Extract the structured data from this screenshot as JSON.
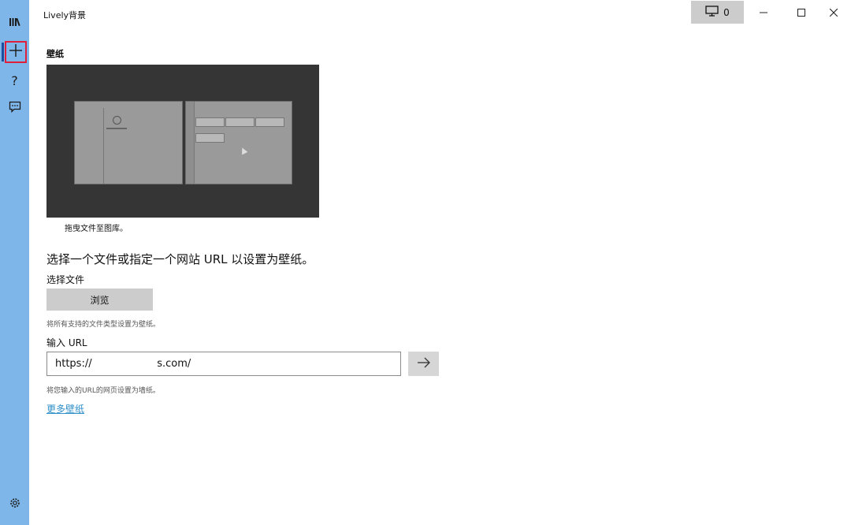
{
  "window": {
    "title": "Lively背景",
    "monitor_count": "0",
    "icons": {
      "monitor": "monitor-icon",
      "minimize": "minimize-icon",
      "maximize": "maximize-icon",
      "close": "close-icon"
    }
  },
  "rail": {
    "items": [
      {
        "name": "library",
        "icon": "library-icon"
      },
      {
        "name": "add-wallpaper",
        "icon": "plus-icon",
        "selected": true
      },
      {
        "name": "help",
        "icon": "question-icon"
      },
      {
        "name": "feedback",
        "icon": "chat-icon"
      }
    ],
    "settings_icon": "gear-icon",
    "accent_color": "#1a4fa0",
    "background_color": "#7eb6ea"
  },
  "main": {
    "section_title": "壁纸",
    "preview_caption": "拖曳文件至图库。",
    "headline": "选择一个文件或指定一个网站 URL 以设置为壁纸。",
    "choose_file_label": "选择文件",
    "browse_label": "浏览",
    "choose_file_hint": "将所有支持的文件类型设置为壁纸。",
    "url_label": "输入 URL",
    "url_value": "https://                    s.com/",
    "url_hint": "将您输入的URL的网页设置为墙纸。",
    "more_link": "更多壁纸",
    "link_color": "#2f8fc8",
    "highlight_color": "#e0203a"
  }
}
